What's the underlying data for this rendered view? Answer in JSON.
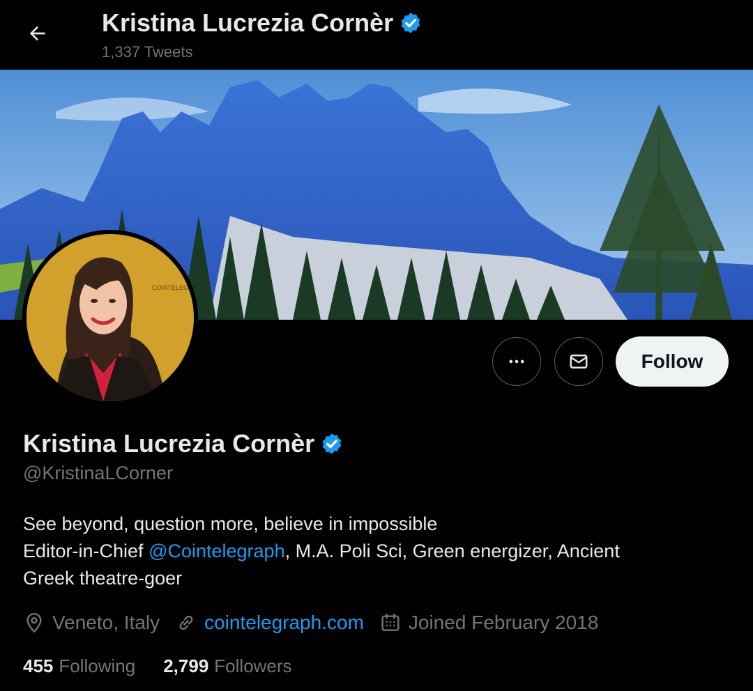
{
  "header": {
    "display_name": "Kristina Lucrezia Cornèr",
    "tweet_count": "1,337 Tweets"
  },
  "actions": {
    "follow_label": "Follow"
  },
  "profile": {
    "display_name": "Kristina Lucrezia Cornèr",
    "handle": "@KristinaLCorner",
    "bio_line1": "See beyond, question more, believe in impossible",
    "bio_line2_prefix": "Editor-in-Chief ",
    "bio_mention": "@Cointelegraph",
    "bio_line2_suffix": ", M.A. Poli Sci, Green energizer, Ancient",
    "bio_line3": "Greek theatre-goer",
    "location": "Veneto, Italy",
    "website": "cointelegraph.com",
    "joined": "Joined February 2018",
    "following_count": "455",
    "following_label": "Following",
    "followers_count": "2,799",
    "followers_label": "Followers",
    "avatar_backdrop_text": "COINTELEGRAPH"
  },
  "colors": {
    "accent": "#1d9bf0",
    "background": "#000000",
    "secondary_text": "#71767b"
  },
  "icons": {
    "back": "arrow-left-icon",
    "verified": "verified-badge-icon",
    "more": "more-icon",
    "message": "envelope-icon",
    "location": "location-pin-icon",
    "link": "link-icon",
    "calendar": "calendar-icon"
  }
}
